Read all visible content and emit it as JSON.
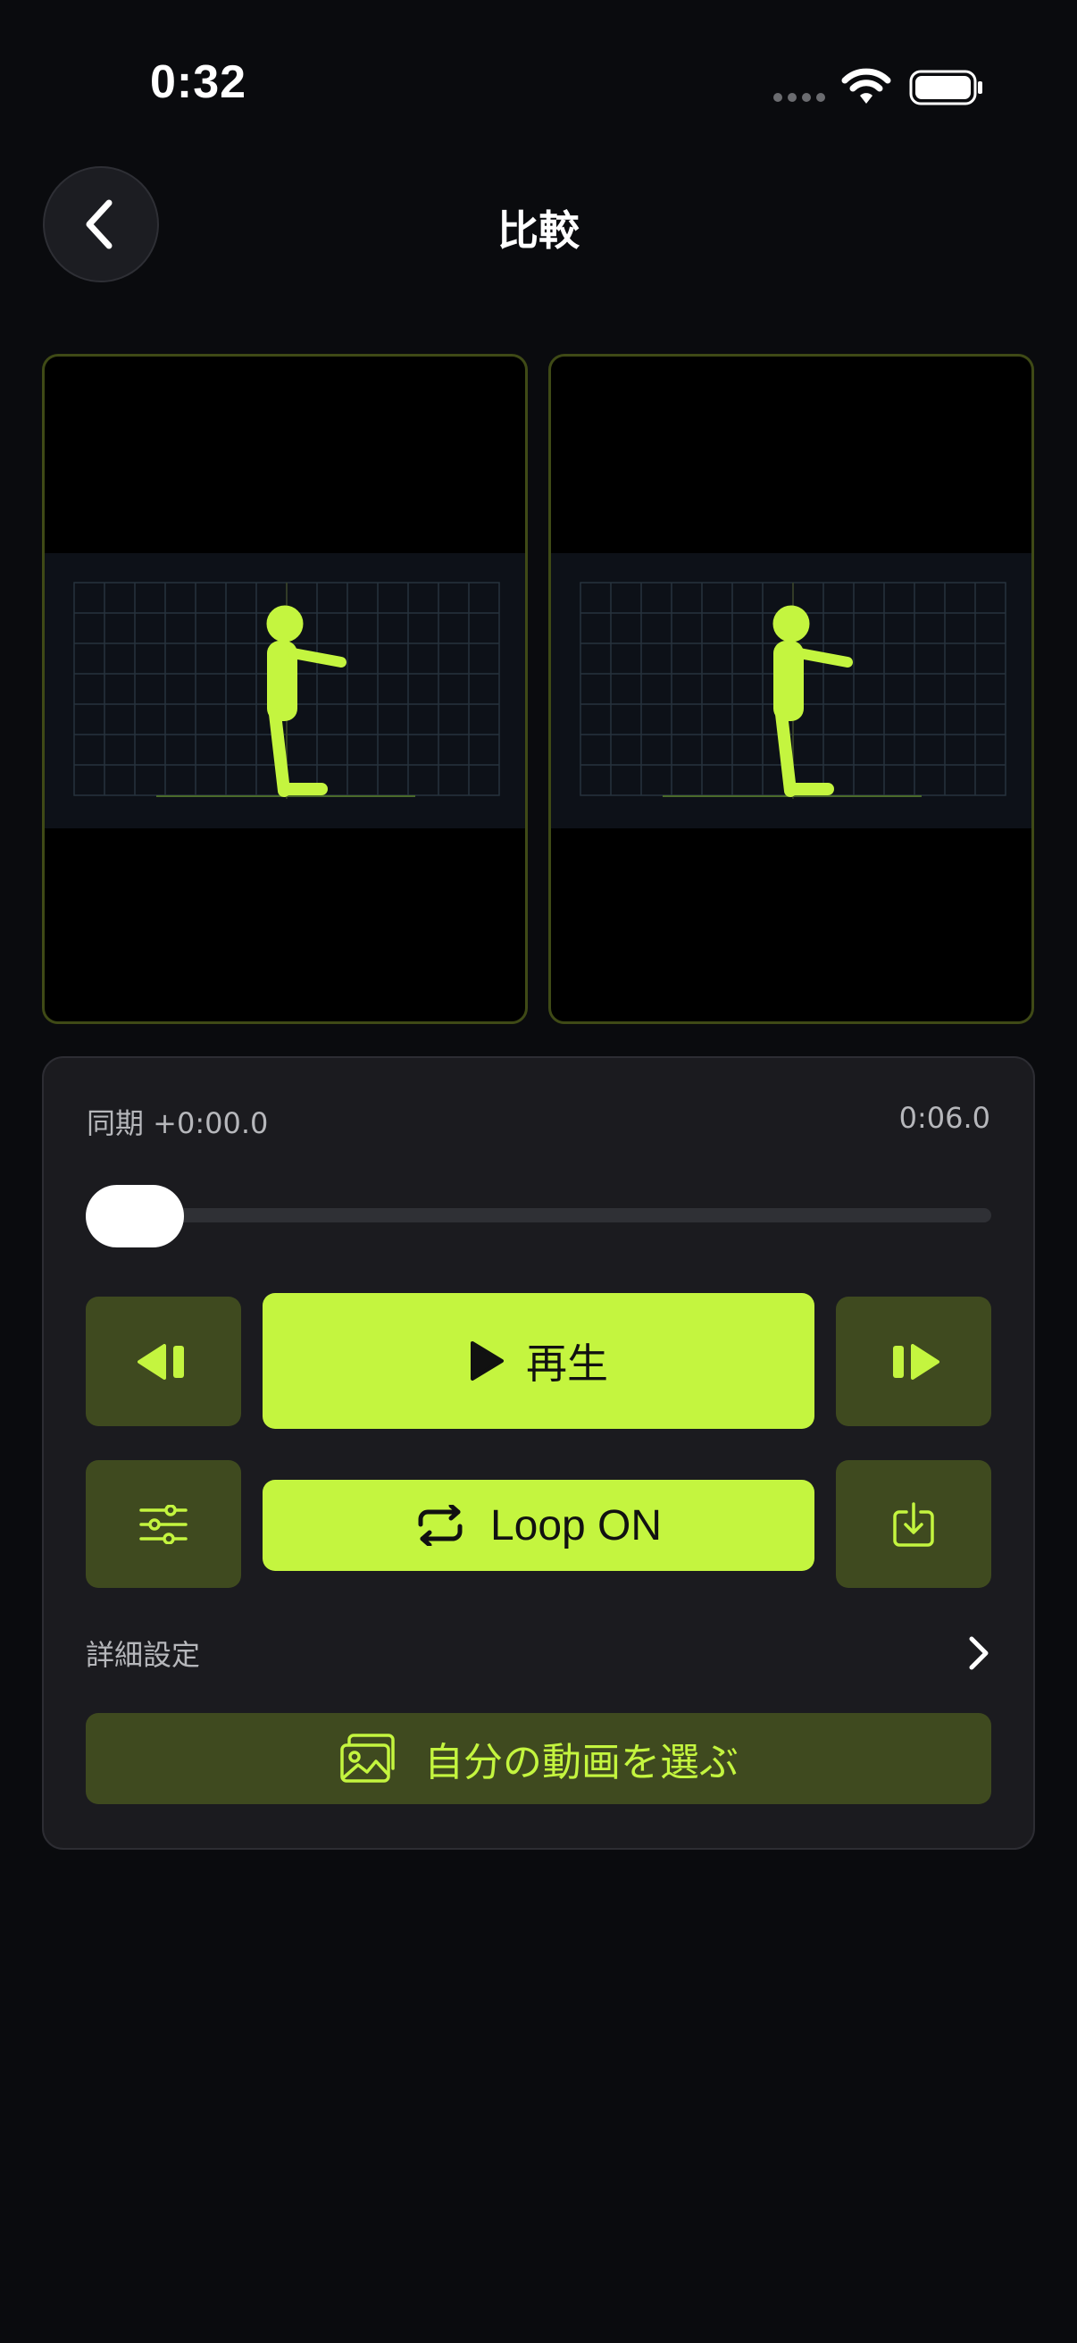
{
  "status_bar": {
    "time": "0:32",
    "icons": [
      "cellular-signal-icon",
      "wifi-icon",
      "battery-icon"
    ]
  },
  "header": {
    "title": "比較",
    "back_icon": "chevron-left-icon"
  },
  "videos": [
    {
      "pane": "left",
      "content": "stick-figure-standing-arms-forward"
    },
    {
      "pane": "right",
      "content": "stick-figure-standing-arms-forward"
    }
  ],
  "controls": {
    "sync_label": "同期 +0:00.0",
    "duration": "0:06.0",
    "scrubber_progress": 0.0,
    "play_label": "再生",
    "loop_label": "Loop ON",
    "advanced_label": "詳細設定",
    "choose_video_label": "自分の動画を選ぶ",
    "icons": [
      "step-back-icon",
      "play-icon",
      "step-forward-icon",
      "sliders-icon",
      "repeat-icon",
      "download-icon",
      "chevron-right-icon",
      "photos-icon"
    ]
  },
  "colors": {
    "accent": "#c4f53f",
    "accent_dark": "#3f4a1f",
    "background": "#0a0b0e",
    "card": "#1b1b1f"
  }
}
